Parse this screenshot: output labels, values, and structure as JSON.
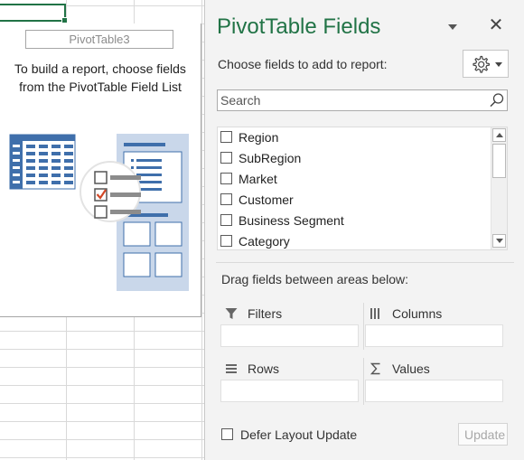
{
  "sheet": {
    "pivot_name": "PivotTable3",
    "instructions_line1": "To build a report, choose fields",
    "instructions_line2": "from the PivotTable Field List"
  },
  "pane": {
    "title": "PivotTable Fields",
    "close_glyph": "✕",
    "choose_label": "Choose fields to add to report:",
    "settings_icon": "gear-icon",
    "search_placeholder": "Search",
    "fields": [
      {
        "label": "Region",
        "checked": false
      },
      {
        "label": "SubRegion",
        "checked": false
      },
      {
        "label": "Market",
        "checked": false
      },
      {
        "label": "Customer",
        "checked": false
      },
      {
        "label": "Business Segment",
        "checked": false
      },
      {
        "label": "Category",
        "checked": false
      }
    ],
    "drag_label": "Drag fields between areas below:",
    "areas": {
      "filters": "Filters",
      "columns": "Columns",
      "rows": "Rows",
      "values": "Values"
    },
    "defer_label": "Defer Layout Update",
    "update_label": "Update",
    "colors": {
      "title": "#217346",
      "accent": "#217346",
      "illustration": "#3f6fab"
    }
  }
}
